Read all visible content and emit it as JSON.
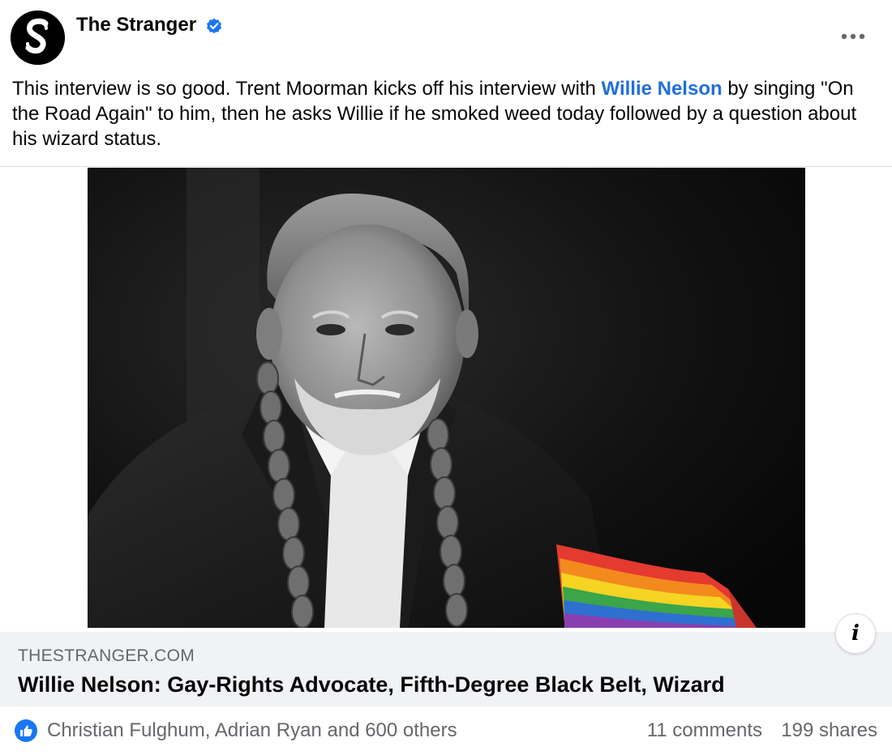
{
  "post": {
    "page_name": "The Stranger",
    "verified": true,
    "avatar_icon": "stranger-s-logo",
    "more_icon": "more-options-icon",
    "message": {
      "before": "This interview is so good. Trent Moorman kicks off his interview with ",
      "mention": "Willie Nelson",
      "after": " by singing \"On the Road Again\" to him, then he asks Willie if he smoked weed today followed by a question about his wizard status."
    },
    "photo": {
      "icon": "photo-black-white-portrait"
    },
    "info_button": "i",
    "link": {
      "domain": "THESTRANGER.COM",
      "title": "Willie Nelson: Gay-Rights Advocate, Fifth-Degree Black Belt, Wizard"
    },
    "reactions": {
      "reactors": "Christian Fulghum, Adrian Ryan and 600 others",
      "comments": "11 comments",
      "shares": "199 shares"
    }
  },
  "colors": {
    "accent": "#216fdb",
    "like_blue": "#1877f2",
    "secondary_text": "#65676b",
    "preview_bg": "#f0f2f5"
  }
}
